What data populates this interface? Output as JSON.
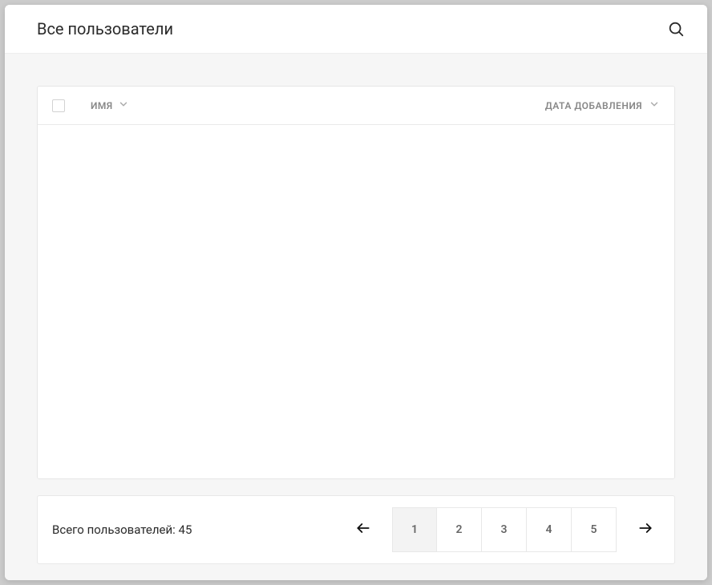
{
  "header": {
    "title": "Все пользователи"
  },
  "table": {
    "columns": {
      "name": "ИМЯ",
      "date_added": "ДАТА ДОБАВЛЕНИЯ"
    }
  },
  "footer": {
    "total_label": "Всего пользователей:",
    "total_count": "45"
  },
  "pagination": {
    "pages": [
      "1",
      "2",
      "3",
      "4",
      "5"
    ],
    "current": "1"
  }
}
